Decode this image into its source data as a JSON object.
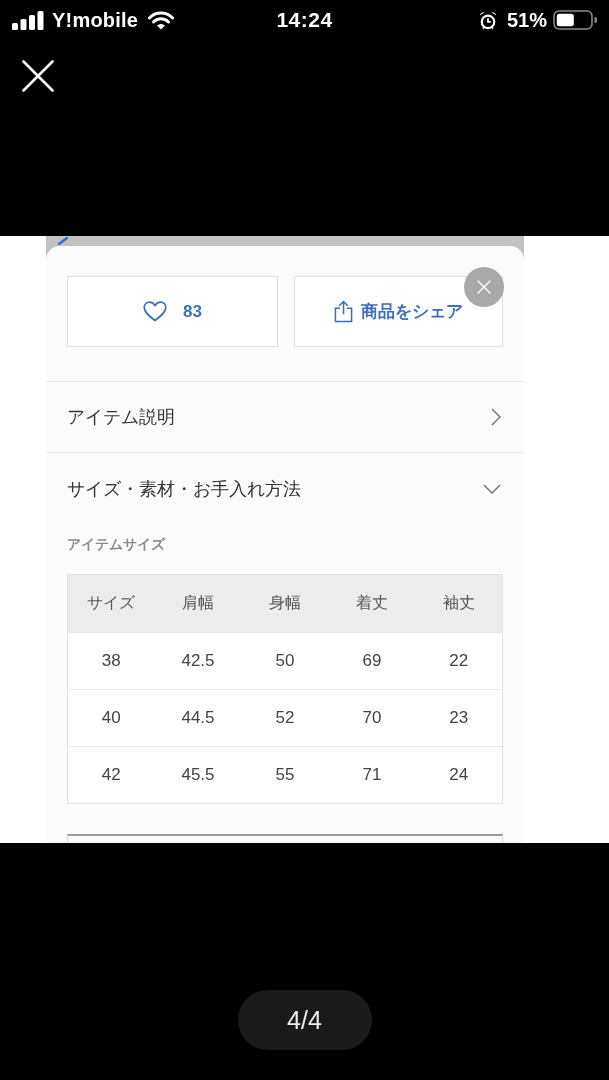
{
  "status_bar": {
    "carrier": "Y!mobile",
    "time": "14:24",
    "battery": "51%"
  },
  "product_sheet": {
    "like_button": {
      "count": "83"
    },
    "share_button": {
      "label": "商品をシェア"
    },
    "sections": [
      {
        "title": "アイテム説明",
        "expanded": false
      },
      {
        "title": "サイズ・素材・お手入れ方法",
        "expanded": true
      }
    ],
    "size_table": {
      "title": "アイテムサイズ",
      "columns": [
        "サイズ",
        "肩幅",
        "身幅",
        "着丈",
        "袖丈"
      ],
      "rows": [
        [
          "38",
          "42.5",
          "50",
          "69",
          "22"
        ],
        [
          "40",
          "44.5",
          "52",
          "70",
          "23"
        ],
        [
          "42",
          "45.5",
          "55",
          "71",
          "24"
        ]
      ]
    }
  },
  "viewer": {
    "page_indicator": "4/4"
  }
}
